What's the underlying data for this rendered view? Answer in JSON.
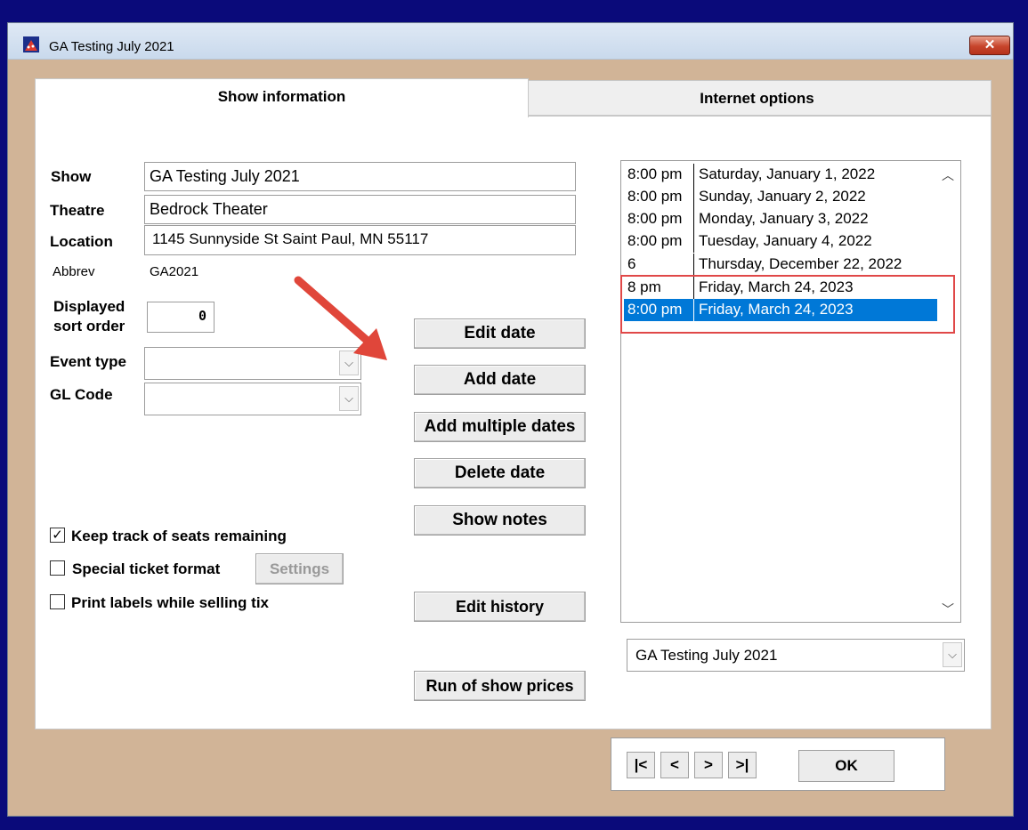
{
  "window": {
    "title": "GA Testing July 2021",
    "close_glyph": "✕"
  },
  "tabs": [
    {
      "label": "Show information",
      "active": true
    },
    {
      "label": "Internet options",
      "active": false
    }
  ],
  "form": {
    "show_label": "Show",
    "show_value": "GA Testing July 2021",
    "theatre_label": "Theatre",
    "theatre_value": "Bedrock Theater",
    "location_label": "Location",
    "location_value": "1145 Sunnyside St Saint Paul, MN 55117",
    "abbrev_label": "Abbrev",
    "abbrev_value": "GA2021",
    "sort_label_line1": "Displayed",
    "sort_label_line2": "sort order",
    "sort_value": "0",
    "event_type_label": "Event type",
    "event_type_value": "",
    "gl_code_label": "GL Code",
    "gl_code_value": ""
  },
  "checkboxes": {
    "keep_track": {
      "label": "Keep track of seats remaining",
      "checked": true
    },
    "special_ticket": {
      "label": "Special ticket format",
      "checked": false
    },
    "print_labels": {
      "label": "Print labels while selling tix",
      "checked": false
    },
    "settings_button": "Settings"
  },
  "buttons": {
    "edit_date": "Edit date",
    "add_date": "Add date",
    "add_multiple": "Add multiple dates",
    "delete_date": "Delete date",
    "show_notes": "Show notes",
    "edit_history": "Edit history",
    "run_prices": "Run of show prices"
  },
  "dates": [
    {
      "time": "8:00 pm",
      "date": "Saturday, January 1, 2022",
      "selected": false
    },
    {
      "time": "8:00 pm",
      "date": "Sunday, January 2, 2022",
      "selected": false
    },
    {
      "time": "8:00 pm",
      "date": "Monday, January 3, 2022",
      "selected": false
    },
    {
      "time": "8:00 pm",
      "date": "Tuesday, January 4, 2022",
      "selected": false
    },
    {
      "time": "6",
      "date": "Thursday, December 22, 2022",
      "selected": false
    },
    {
      "time": "8 pm",
      "date": "Friday, March 24, 2023",
      "selected": false
    },
    {
      "time": "8:00 pm",
      "date": "Friday, March 24, 2023",
      "selected": true
    }
  ],
  "show_select": {
    "value": "GA Testing July 2021"
  },
  "nav": {
    "first": "|<",
    "prev": "<",
    "next": ">",
    "last": ">|",
    "ok": "OK"
  },
  "colors": {
    "annotation_arrow": "#e0463a",
    "highlight_box": "#e04848",
    "selection": "#0078d7"
  }
}
